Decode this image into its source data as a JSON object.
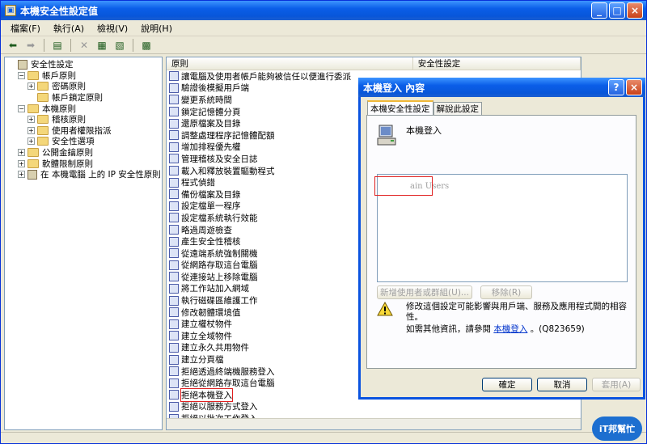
{
  "window": {
    "title": "本機安全性設定值"
  },
  "menu": [
    "檔案(F)",
    "執行(A)",
    "檢視(V)",
    "說明(H)"
  ],
  "tree": [
    {
      "label": "安全性設定",
      "level": 0,
      "toggle": "",
      "icon": "security-settings-icon"
    },
    {
      "label": "帳戶原則",
      "level": 1,
      "toggle": "−",
      "icon": "folder-icon"
    },
    {
      "label": "密碼原則",
      "level": 2,
      "toggle": "+",
      "icon": "folder-icon"
    },
    {
      "label": "帳戶鎖定原則",
      "level": 2,
      "toggle": "",
      "icon": "folder-icon"
    },
    {
      "label": "本機原則",
      "level": 1,
      "toggle": "−",
      "icon": "folder-icon"
    },
    {
      "label": "稽核原則",
      "level": 2,
      "toggle": "+",
      "icon": "folder-icon"
    },
    {
      "label": "使用者權限指派",
      "level": 2,
      "toggle": "+",
      "icon": "folder-icon"
    },
    {
      "label": "安全性選項",
      "level": 2,
      "toggle": "+",
      "icon": "folder-icon"
    },
    {
      "label": "公開金鑰原則",
      "level": 1,
      "toggle": "+",
      "icon": "folder-icon"
    },
    {
      "label": "軟體限制原則",
      "level": 1,
      "toggle": "+",
      "icon": "folder-icon"
    },
    {
      "label": "在 本機電腦 上的 IP 安全性原則",
      "level": 1,
      "toggle": "+",
      "icon": "ip-security-icon"
    }
  ],
  "list_header": {
    "policy": "原則",
    "setting": "安全性設定"
  },
  "policies": [
    "讓電腦及使用者帳戶能夠被信任以便進行委派",
    "驗證後模擬用戶端",
    "變更系統時間",
    "鎖定記憶體分頁",
    "還原檔案及目錄",
    "調整處理程序記憶體配額",
    "增加排程優先權",
    "管理稽核及安全日誌",
    "載入和釋放裝置驅動程式",
    "程式偵錯",
    "備份檔案及目錄",
    "設定檔單一程序",
    "設定檔系統執行效能",
    "略過周遊檢查",
    "產生安全性稽核",
    "從遠端系統強制關機",
    "從網路存取這台電腦",
    "從連接站上移除電腦",
    "將工作站加入網域",
    "執行磁碟區維護工作",
    "修改韌體環境值",
    "建立權杖物件",
    "建立全域物件",
    "建立永久共用物件",
    "建立分頁檔",
    "拒絕透過終端機服務登入",
    "拒絕從網路存取這台電腦",
    "拒絕本機登入",
    "拒絕以服務方式登入",
    "拒絕以批次工作登入"
  ],
  "highlighted_policy": "拒絕本機登入",
  "dialog": {
    "title": "本機登入 內容",
    "tabs": [
      "本機安全性設定",
      "解說此設定"
    ],
    "policy_name": "本機登入",
    "user_entry": "ain Users",
    "add_button": "新增使用者或群組(U)...",
    "remove_button": "移除(R)",
    "warning_text": "修改這個設定可能影響與用戶端、服務及應用程式間的相容性。",
    "info_prefix": "如需其他資訊，請參閱",
    "info_link": "本機登入",
    "info_suffix": "。(Q823659)",
    "ok_button": "確定",
    "cancel_button": "取消",
    "apply_button": "套用(A)",
    "help_button": "?",
    "close_button": "×"
  },
  "logo": {
    "text": "iT邦幫忙"
  },
  "colors": {
    "titlebar": "#0a5ee8",
    "highlight_outline": "#e02020"
  }
}
